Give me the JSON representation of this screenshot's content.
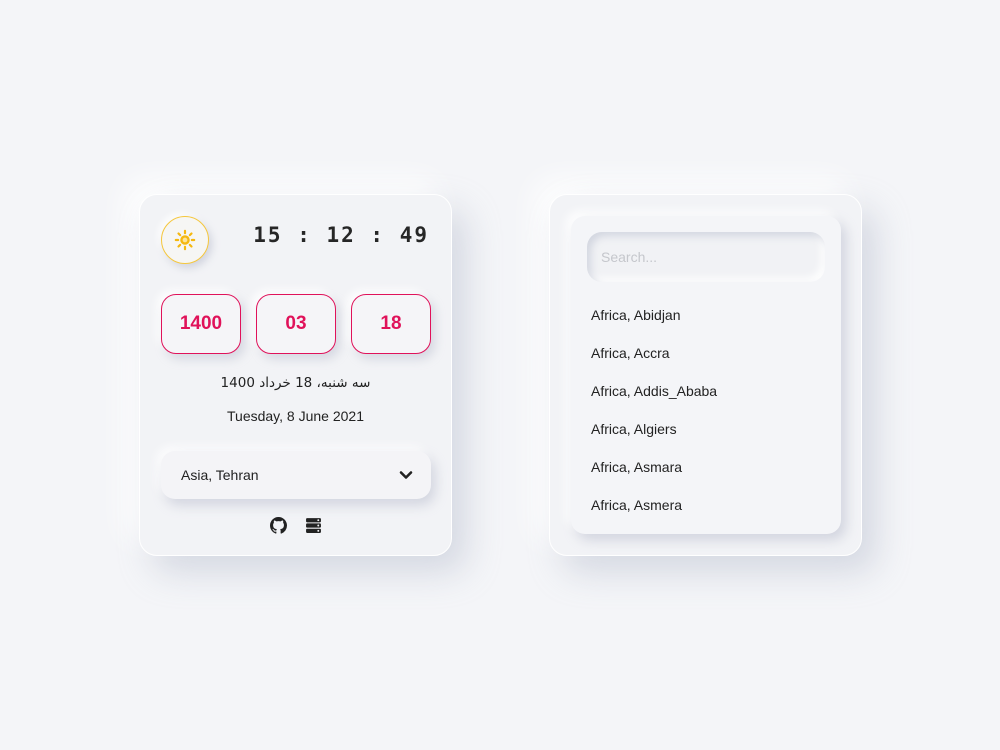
{
  "clock": {
    "time": "15 : 12 : 49",
    "date_boxes": [
      "1400",
      "03",
      "18"
    ],
    "persian_date": "سه شنبه، 18 خرداد 1400",
    "gregorian_date": "Tuesday, 8 June 2021",
    "timezone_selected": "Asia, Tehran",
    "icons": {
      "theme": "sun-icon",
      "dropdown": "chevron-down-icon",
      "github": "github-icon",
      "server": "server-icon"
    }
  },
  "timezones": {
    "search_placeholder": "Search...",
    "items": [
      "Africa, Abidjan",
      "Africa, Accra",
      "Africa, Addis_Ababa",
      "Africa, Algiers",
      "Africa, Asmara",
      "Africa, Asmera"
    ]
  },
  "colors": {
    "accent": "#e0125a",
    "sun": "#f5b80f",
    "background": "#f4f5f8"
  }
}
